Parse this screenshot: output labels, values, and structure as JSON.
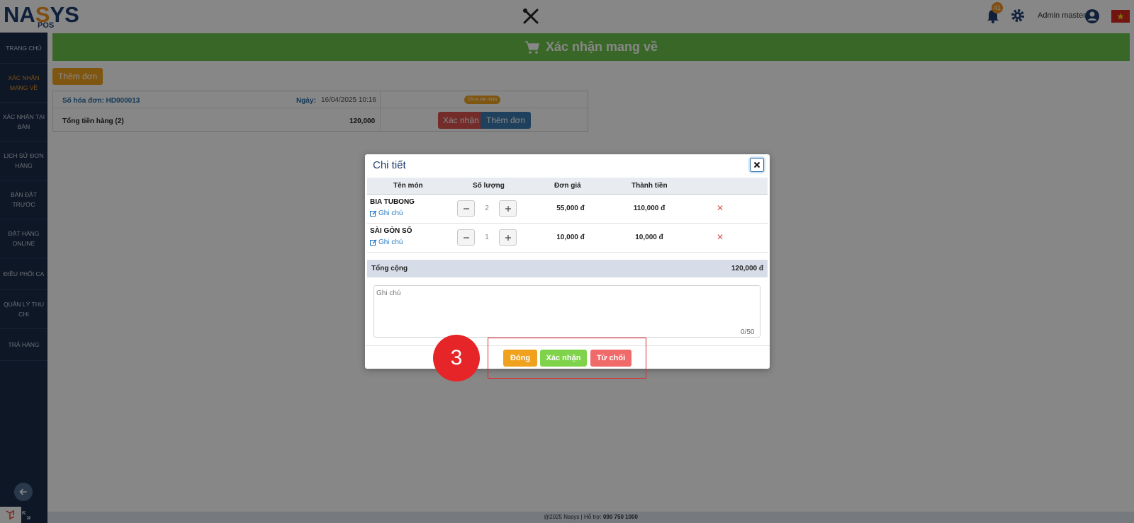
{
  "header": {
    "logo_main": "NA",
    "logo_mid": "S",
    "logo_end": "YS",
    "logo_sub": "POS",
    "notifications": "41",
    "user_name": "Admin master"
  },
  "sidebar": {
    "items": [
      {
        "label": "TRANG CHỦ"
      },
      {
        "label": "XÁC NHẬN MANG VỀ"
      },
      {
        "label": "XÁC NHẬN TẠI BÀN"
      },
      {
        "label": "LỊCH SỬ ĐƠN HÀNG"
      },
      {
        "label": "BÀN ĐẶT TRƯỚC"
      },
      {
        "label": "ĐẶT HÀNG ONLINE"
      },
      {
        "label": "ĐIỀU PHỐI CA"
      },
      {
        "label": "QUẢN LÝ THU CHI"
      },
      {
        "label": "TRẢ HÀNG"
      }
    ]
  },
  "main": {
    "banner_title": "Xác nhận mang về",
    "add_order_label": "Thêm đơn",
    "order": {
      "invoice_label": "Số hóa đơn: HD000013",
      "date_label": "Ngày:",
      "date_value": "16/04/2025 10:16",
      "status": "Chưa xác nhận",
      "total_label": "Tổng tiền hàng (2)",
      "total_value": "120,000",
      "confirm_label": "Xác nhận",
      "add_label": "Thêm đơn"
    },
    "footer": {
      "text": "@2025 Nasys | Hỗ trợ: ",
      "phone": "090 750 1000"
    }
  },
  "modal": {
    "title": "Chi tiết",
    "columns": [
      "Tên món",
      "Số lượng",
      "Đơn giá",
      "Thành tiền"
    ],
    "items": [
      {
        "name": "BIA TUBONG",
        "note": "Ghi chú",
        "qty": "2",
        "price": "55,000 đ",
        "total": "110,000 đ"
      },
      {
        "name": "SÀI GÒN SỐ",
        "note": "Ghi chú",
        "qty": "1",
        "price": "10,000 đ",
        "total": "10,000 đ"
      }
    ],
    "sum_label": "Tổng cộng",
    "sum_value": "120,000 đ",
    "note_placeholder": "Ghi chú",
    "note_count": "0/50",
    "close_label": "Đóng",
    "confirm_label": "Xác nhận",
    "reject_label": "Từ chối"
  },
  "annotation": {
    "step": "3"
  },
  "colors": {
    "brand_navy": "#1f3d70",
    "brand_orange": "#f0941f",
    "banner_green": "#6cc24a",
    "danger_red": "#d9534f",
    "annotation_red": "#e52527"
  }
}
